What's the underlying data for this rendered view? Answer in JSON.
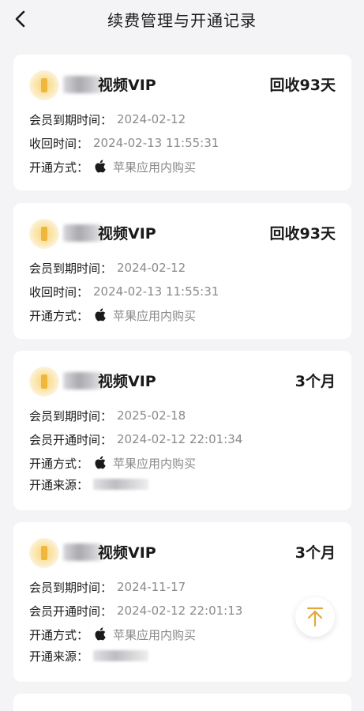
{
  "header": {
    "title": "续费管理与开通记录"
  },
  "colors": {
    "background": "#f4f4f6",
    "card": "#ffffff",
    "accent": "#e2a93a",
    "muted": "#8a8a8a"
  },
  "icons": {
    "back": "chevron-left-icon",
    "crown": "vip-crown-icon",
    "apple": "apple-icon",
    "top": "back-to-top-icon"
  },
  "cards": [
    {
      "vip_name": "视频VIP",
      "badge": "回收93天",
      "rows": [
        {
          "label": "会员到期时间：",
          "value": "2024-02-12"
        },
        {
          "label": "收回时间：",
          "value": "2024-02-13 11:55:31"
        },
        {
          "label": "开通方式：",
          "value": "苹果应用内购买"
        }
      ]
    },
    {
      "vip_name": "视频VIP",
      "badge": "回收93天",
      "rows": [
        {
          "label": "会员到期时间：",
          "value": "2024-02-12"
        },
        {
          "label": "收回时间：",
          "value": "2024-02-13 11:55:31"
        },
        {
          "label": "开通方式：",
          "value": "苹果应用内购买"
        }
      ]
    },
    {
      "vip_name": "视频VIP",
      "badge": "3个月",
      "rows": [
        {
          "label": "会员到期时间：",
          "value": "2025-02-18"
        },
        {
          "label": "会员开通时间：",
          "value": "2024-02-12 22:01:34"
        },
        {
          "label": "开通方式：",
          "value": "苹果应用内购买"
        },
        {
          "label": "开通来源：",
          "value": ""
        }
      ]
    },
    {
      "vip_name": "视频VIP",
      "badge": "3个月",
      "rows": [
        {
          "label": "会员到期时间：",
          "value": "2024-11-17"
        },
        {
          "label": "会员开通时间：",
          "value": "2024-02-12 22:01:13"
        },
        {
          "label": "开通方式：",
          "value": "苹果应用内购买"
        },
        {
          "label": "开通来源：",
          "value": ""
        }
      ]
    }
  ]
}
